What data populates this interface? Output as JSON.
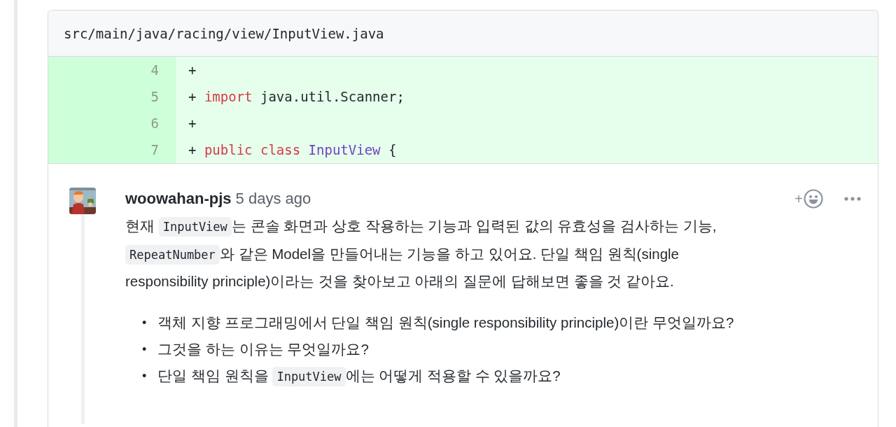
{
  "file": {
    "path": "src/main/java/racing/view/InputView.java"
  },
  "diff_lines": [
    {
      "kind": "added",
      "number": "4",
      "tokens": [
        {
          "kind": "plain",
          "text": "+"
        }
      ]
    },
    {
      "kind": "added",
      "number": "5",
      "tokens": [
        {
          "kind": "plain",
          "text": "+ "
        },
        {
          "kind": "keyword",
          "text": "import"
        },
        {
          "kind": "plain",
          "text": " java.util.Scanner;"
        }
      ]
    },
    {
      "kind": "added",
      "number": "6",
      "tokens": [
        {
          "kind": "plain",
          "text": "+"
        }
      ]
    },
    {
      "kind": "added",
      "number": "7",
      "tokens": [
        {
          "kind": "plain",
          "text": "+ "
        },
        {
          "kind": "keyword",
          "text": "public"
        },
        {
          "kind": "keyword",
          "text": " class"
        },
        {
          "kind": "type",
          "text": " InputView"
        },
        {
          "kind": "plain",
          "text": " {"
        }
      ]
    }
  ],
  "comment": {
    "author": "woowahan-pjs",
    "time": "5 days ago",
    "reaction_button": "+",
    "paragraph": [
      {
        "kind": "text",
        "text": "현재 "
      },
      {
        "kind": "code",
        "text": "InputView"
      },
      {
        "kind": "text",
        "text": "는 콘솔 화면과 상호 작용하는 기능과 입력된 값의 유효성을 검사하는 기능,"
      },
      {
        "kind": "break"
      },
      {
        "kind": "code",
        "text": "RepeatNumber"
      },
      {
        "kind": "text",
        "text": "와 같은 Model을 만들어내는 기능을 하고 있어요. 단일 책임 원칙(single"
      },
      {
        "kind": "break"
      },
      {
        "kind": "text",
        "text": "responsibility principle)이라는 것을 찾아보고 아래의 질문에 답해보면 좋을 것 같아요."
      }
    ],
    "questions": [
      {
        "bullet": "•",
        "parts": [
          {
            "kind": "text",
            "text": "객체 지향 프로그래밍에서 단일 책임 원칙(single responsibility principle)이란 무엇일까요?"
          }
        ]
      },
      {
        "bullet": "•",
        "parts": [
          {
            "kind": "text",
            "text": "그것을 하는 이유는 무엇일까요?"
          }
        ]
      },
      {
        "bullet": "•",
        "parts": [
          {
            "kind": "text",
            "text": "단일 책임 원칙을 "
          },
          {
            "kind": "code",
            "text": "InputView"
          },
          {
            "kind": "text",
            "text": "에는 어떻게 적용할 수 있을까요?"
          }
        ]
      }
    ]
  }
}
